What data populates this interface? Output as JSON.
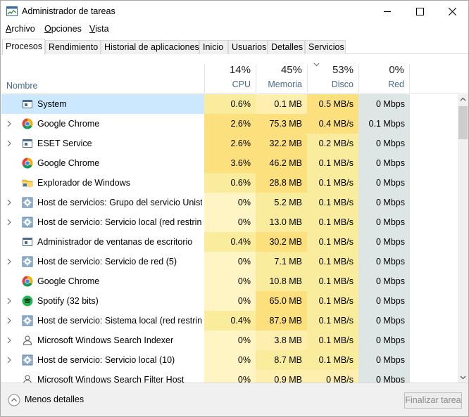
{
  "window": {
    "title": "Administrador de tareas"
  },
  "menu": [
    {
      "u": "A",
      "rest": "rchivo"
    },
    {
      "u": "O",
      "rest": "pciones"
    },
    {
      "u": "V",
      "rest": "ista"
    }
  ],
  "tabs": [
    "Procesos",
    "Rendimiento",
    "Historial de aplicaciones",
    "Inicio",
    "Usuarios",
    "Detalles",
    "Servicios"
  ],
  "active_tab": "Procesos",
  "columns": {
    "name": "Nombre",
    "cpu": {
      "pct": "14%",
      "label": "CPU"
    },
    "memory": {
      "pct": "45%",
      "label": "Memoria"
    },
    "disk": {
      "pct": "53%",
      "label": "Disco",
      "sorted": true
    },
    "network": {
      "pct": "0%",
      "label": "Red"
    }
  },
  "heat_colors": {
    "light": "#fff4c4",
    "medium": "#ffefaf",
    "strong": "#f9ec9c",
    "hot": "#fbe07d",
    "gray": "#dde5e5"
  },
  "processes": [
    {
      "name": "System",
      "icon": "window-app-icon",
      "expandable": false,
      "selected": true,
      "cpu": "0.6%",
      "memory": "0.1 MB",
      "disk": "0.5 MB/s",
      "network": "0 Mbps"
    },
    {
      "name": "Google Chrome",
      "icon": "chrome-icon",
      "expandable": true,
      "cpu": "2.6%",
      "memory": "75.3 MB",
      "disk": "0.4 MB/s",
      "network": "0.1 Mbps"
    },
    {
      "name": "ESET Service",
      "icon": "window-app-icon",
      "expandable": true,
      "cpu": "2.6%",
      "memory": "32.2 MB",
      "disk": "0.2 MB/s",
      "network": "0 Mbps"
    },
    {
      "name": "Google Chrome",
      "icon": "chrome-icon",
      "expandable": false,
      "cpu": "3.6%",
      "memory": "46.2 MB",
      "disk": "0.1 MB/s",
      "network": "0 Mbps"
    },
    {
      "name": "Explorador de Windows",
      "icon": "folder-icon",
      "expandable": false,
      "cpu": "0.6%",
      "memory": "28.8 MB",
      "disk": "0.1 MB/s",
      "network": "0 Mbps"
    },
    {
      "name": "Host de servicios: Grupo del servicio Unist...",
      "icon": "gear-icon",
      "expandable": true,
      "cpu": "0%",
      "memory": "5.2 MB",
      "disk": "0.1 MB/s",
      "network": "0 Mbps"
    },
    {
      "name": "Host de servicio: Servicio local (red restrin...",
      "icon": "gear-icon",
      "expandable": true,
      "cpu": "0%",
      "memory": "13.0 MB",
      "disk": "0.1 MB/s",
      "network": "0 Mbps"
    },
    {
      "name": "Administrador de ventanas de escritorio",
      "icon": "window-app-icon",
      "expandable": false,
      "cpu": "0.4%",
      "memory": "30.2 MB",
      "disk": "0.1 MB/s",
      "network": "0 Mbps"
    },
    {
      "name": "Host de servicio: Servicio de red (5)",
      "icon": "gear-icon",
      "expandable": true,
      "cpu": "0%",
      "memory": "7.1 MB",
      "disk": "0.1 MB/s",
      "network": "0 Mbps"
    },
    {
      "name": "Google Chrome",
      "icon": "chrome-icon",
      "expandable": false,
      "cpu": "0%",
      "memory": "10.8 MB",
      "disk": "0.1 MB/s",
      "network": "0 Mbps"
    },
    {
      "name": "Spotify (32 bits)",
      "icon": "spotify-icon",
      "expandable": true,
      "cpu": "0%",
      "memory": "65.0 MB",
      "disk": "0.1 MB/s",
      "network": "0 Mbps"
    },
    {
      "name": "Host de servicio: Sistema local (red restrin...",
      "icon": "gear-icon",
      "expandable": true,
      "cpu": "0.4%",
      "memory": "87.9 MB",
      "disk": "0.1 MB/s",
      "network": "0 Mbps"
    },
    {
      "name": "Microsoft Windows Search Indexer",
      "icon": "search-user-icon",
      "expandable": true,
      "cpu": "0%",
      "memory": "3.8 MB",
      "disk": "0.1 MB/s",
      "network": "0 Mbps"
    },
    {
      "name": "Host de servicio: Servicio local (10)",
      "icon": "gear-icon",
      "expandable": true,
      "cpu": "0%",
      "memory": "8.7 MB",
      "disk": "0.1 MB/s",
      "network": "0 Mbps"
    },
    {
      "name": "Microsoft Windows Search Filter Host",
      "icon": "search-user-icon",
      "expandable": false,
      "cpu": "0%",
      "memory": "0.9 MB",
      "disk": "0 MB/s",
      "network": "0 Mbps"
    }
  ],
  "footer": {
    "less_details": "Menos detalles",
    "end_task": "Finalizar tarea"
  }
}
